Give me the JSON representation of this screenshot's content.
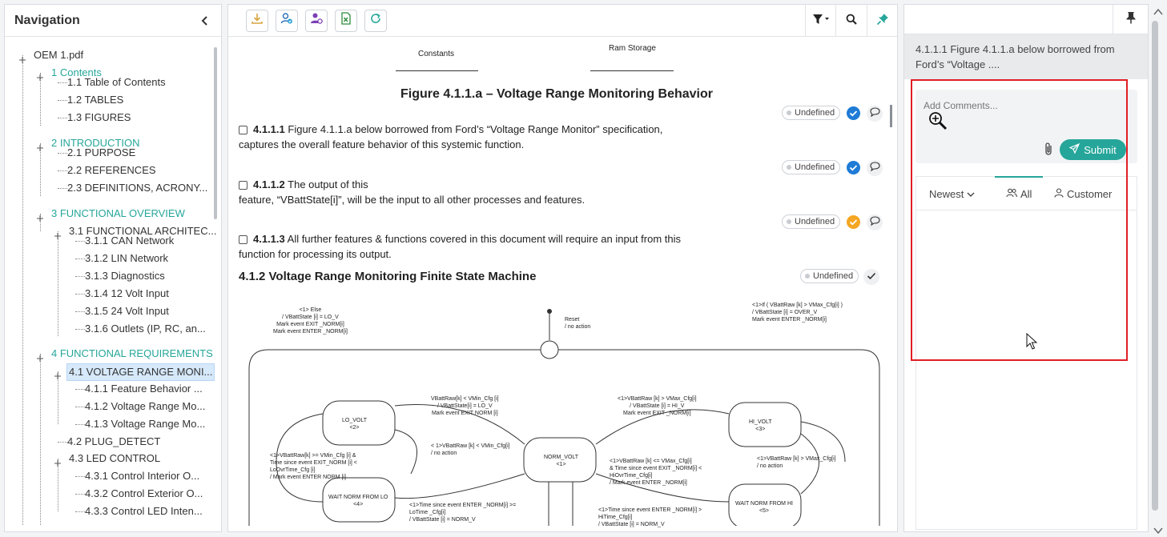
{
  "nav": {
    "title": "Navigation",
    "tree": [
      {
        "label": "OEM 1.pdf"
      },
      {
        "label": "1 Contents"
      },
      {
        "label": "1.1 Table of Contents"
      },
      {
        "label": "1.2 TABLES"
      },
      {
        "label": "1.3 FIGURES"
      },
      {
        "label": "2 INTRODUCTION"
      },
      {
        "label": "2.1 PURPOSE"
      },
      {
        "label": "2.2 REFERENCES"
      },
      {
        "label": "2.3 DEFINITIONS, ACRONY..."
      },
      {
        "label": "3 FUNCTIONAL OVERVIEW"
      },
      {
        "label": "3.1 FUNCTIONAL ARCHITEC..."
      },
      {
        "label": "3.1.1 CAN Network"
      },
      {
        "label": "3.1.2 LIN Network"
      },
      {
        "label": "3.1.3 Diagnostics"
      },
      {
        "label": "3.1.4 12 Volt Input"
      },
      {
        "label": "3.1.5 24 Volt Input"
      },
      {
        "label": "3.1.6 Outlets (IP, RC, an..."
      },
      {
        "label": "4 FUNCTIONAL REQUIREMENTS"
      },
      {
        "label": "4.1 VOLTAGE RANGE MONI..."
      },
      {
        "label": "4.1.1 Feature Behavior ..."
      },
      {
        "label": "4.1.2 Voltage Range Mo..."
      },
      {
        "label": "4.1.3 Voltage Range Mo..."
      },
      {
        "label": "4.2 PLUG_DETECT"
      },
      {
        "label": "4.3 LED CONTROL"
      },
      {
        "label": "4.3.1 Control Interior O..."
      },
      {
        "label": "4.3.2 Control Exterior O..."
      },
      {
        "label": "4.3.3 Control LED Inten..."
      }
    ]
  },
  "doc": {
    "top_labels": {
      "left": "Constants",
      "right": "Ram Storage"
    },
    "figure_title": "Figure 4.1.1.a – Voltage Range Monitoring Behavior",
    "requirements": [
      {
        "id": "4.1.1.1",
        "line1": "Figure 4.1.1.a below borrowed from Ford’s “Voltage Range Monitor” specification,",
        "line2": "captures the overall feature behavior of this systemic function.",
        "status": "Undefined"
      },
      {
        "id": "4.1.1.2",
        "line1": "The output of this",
        "line2": "feature, “VBattState[i]”, will be the input to all other processes and features.",
        "status": "Undefined"
      },
      {
        "id": "4.1.1.3",
        "line1": "All further features & functions covered in this document will require an input from this",
        "line2": "function for processing its output.",
        "status": "Undefined"
      }
    ],
    "section_heading": "4.1.2 Voltage Range Monitoring Finite State Machine",
    "section_status": "Undefined",
    "diagram": {
      "states": {
        "lo": [
          "LO_VOLT",
          "<2>"
        ],
        "norm": [
          "NORM_VOLT",
          "<1>"
        ],
        "hi": [
          "HI_VOLT",
          "<3>"
        ],
        "wait_lo": [
          "WAIT NORM FROM LO",
          "<4>"
        ],
        "wait_hi": [
          "WAIT NORM FROM HI",
          "<5>"
        ]
      },
      "reset": [
        "Reset",
        "/ no action"
      ],
      "else_label": [
        "<1> Else",
        "/ VBattState [i] = LO_V",
        "Mark event EXIT _NORM[i]",
        "Mark event ENTER _NORM[i]"
      ],
      "over_label": [
        "<1>If ( VBattRaw [k] > VMax_Cfg[i] )",
        "/ VBattState [i] = OVER_V",
        "Mark event ENTER _NORM[i]"
      ],
      "t_norm_lo": [
        "VBattRaw[k] < VMin_Cfg [i]",
        "/ VBattState[i] = LO_V",
        "Mark event EXIT NORM [i]"
      ],
      "t_norm_hi": [
        "<1>VBattRaw [k] > VMax_Cfg[i]",
        "/ VBattState [i] = HI_V",
        "Mark event EXIT _NORM[i]"
      ],
      "t_lo_stay": [
        "< 1>VBattRaw [k] < VMin_Cfg[i]",
        "/ no action"
      ],
      "t_lo_wait": [
        "<1>VBattRaw[k] >= VMin_Cfg [i] &",
        "Time since event EXIT_NORM [i] <",
        "LoOvrTime_Cfg [i]",
        "/ Mark event ENTER NORM [i]"
      ],
      "t_hi_wait": [
        "<1>VBattRaw [k] <= VMax_Cfg[i]",
        "& Time since event EXIT _NORM[i] <",
        "HiOvrTime_Cfg[i]",
        "/ Mark event ENTER _NORM[i]"
      ],
      "t_hi_stay": [
        "<1>VBattRaw [k] > VMax_Cfg[i]",
        "/ no action"
      ],
      "t_waitlo_norm": [
        "<1>Time since event ENTER _NORM[i] >=",
        "LoTime _Cfg[i]",
        "/ VBattState [i] = NORM_V"
      ],
      "t_waithi_norm": [
        "<1>Time since event ENTER _NORM[i] >",
        "HiTime_Cfg[i]",
        "/ VBattState [i] = NORM_V"
      ]
    }
  },
  "right": {
    "requirement_ref": "4.1.1.1 Figure 4.1.1.a below borrowed from Ford’s “Voltage ....",
    "comment_placeholder": "Add Comments...",
    "submit_label": "Submit",
    "filters": {
      "sort": "Newest",
      "all": "All",
      "customer": "Customer"
    }
  },
  "colors": {
    "accent": "#26a69a",
    "highlight": "#e01f26",
    "status_blue": "#1e7bd6",
    "status_orange": "#f5a623"
  },
  "icons": [
    "download-icon",
    "user-check-icon",
    "user-settings-icon",
    "excel-icon",
    "refresh-icon",
    "filter-icon",
    "search-icon",
    "pin-icon",
    "comment-icon",
    "paperclip-icon",
    "send-icon",
    "users-icon",
    "user-icon",
    "zoom-cursor-icon",
    "mouse-pointer-icon"
  ]
}
